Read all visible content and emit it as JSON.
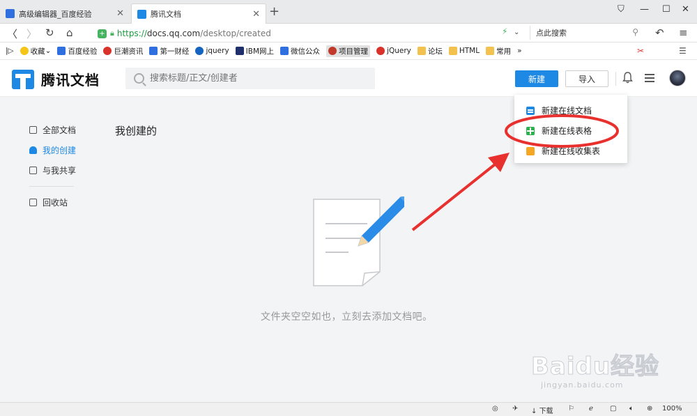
{
  "browser": {
    "tabs": [
      {
        "title": "高级编辑器_百度经验",
        "active": false,
        "favicon_color": "#2f6fe0"
      },
      {
        "title": "腾讯文档",
        "active": true,
        "favicon_color": "#1e88e5"
      }
    ],
    "new_tab_symbol": "+",
    "window_controls": [
      "☐",
      "—",
      "☐",
      "✕"
    ],
    "url": {
      "scheme": "https://",
      "host": "docs.qq.com",
      "path": "/desktop/created"
    },
    "search_placeholder": "点此搜索",
    "bookmarks": [
      {
        "label": "收藏",
        "icon_color": "#f5c518"
      },
      {
        "label": "百度经验",
        "icon_color": "#2f6fe0"
      },
      {
        "label": "巨潮资讯",
        "icon_color": "#d9322a"
      },
      {
        "label": "第一财经",
        "icon_color": "#2f6fe0"
      },
      {
        "label": "jquery",
        "icon_color": "#1565c0"
      },
      {
        "label": "IBM网上",
        "icon_color": "#1f2f6b"
      },
      {
        "label": "微信公众",
        "icon_color": "#2f6fe0"
      },
      {
        "label": "项目管理",
        "icon_color": "#c0392b"
      },
      {
        "label": "jQuery",
        "icon_color": "#d9322a"
      },
      {
        "label": "论坛",
        "icon_color": "#f2c14e"
      },
      {
        "label": "HTML",
        "icon_color": "#f2c14e"
      },
      {
        "label": "常用",
        "icon_color": "#f2c14e"
      }
    ],
    "bookmarks_more": "»",
    "status_bar": {
      "download_label": "下载",
      "zoom": "100%"
    }
  },
  "app": {
    "logo_text": "腾讯文档",
    "search_placeholder": "搜索标题/正文/创建者",
    "new_button": "新建",
    "import_button": "导入",
    "colors": {
      "brand": "#1e88e5",
      "annotation": "#e8312f"
    }
  },
  "sidebar": {
    "items": [
      {
        "label": "全部文档",
        "icon": "documents-icon",
        "active": false
      },
      {
        "label": "我的创建",
        "icon": "user-icon",
        "active": true
      },
      {
        "label": "与我共享",
        "icon": "shared-users-icon",
        "active": false
      }
    ],
    "trash": {
      "label": "回收站",
      "icon": "trash-icon"
    }
  },
  "main": {
    "title": "我创建的",
    "empty_message": "文件夹空空如也，立刻去添加文档吧。"
  },
  "new_menu": {
    "items": [
      {
        "label": "新建在线文档",
        "icon": "doc-icon",
        "color": "#1e88e5"
      },
      {
        "label": "新建在线表格",
        "icon": "sheet-icon",
        "color": "#2bb24c",
        "highlighted": true
      },
      {
        "label": "新建在线收集表",
        "icon": "form-icon",
        "color": "#f5a623"
      }
    ]
  },
  "watermark": {
    "text": "Baidu经验",
    "url": "jingyan.baidu.com"
  }
}
